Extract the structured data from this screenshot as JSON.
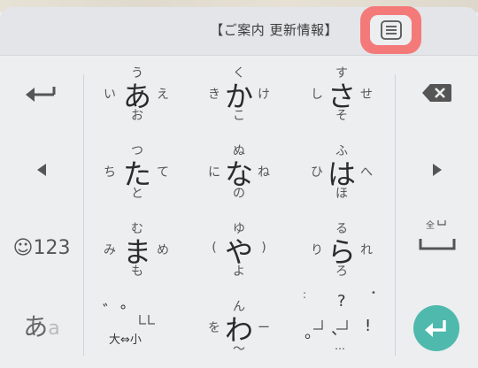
{
  "notice": "【ご案内 更新情報】",
  "rows": [
    [
      {
        "center": "あ",
        "top": "う",
        "left": "い",
        "right": "え",
        "bottom": "お"
      },
      {
        "center": "か",
        "top": "く",
        "left": "き",
        "right": "け",
        "bottom": "こ"
      },
      {
        "center": "さ",
        "top": "す",
        "left": "し",
        "right": "せ",
        "bottom": "そ"
      }
    ],
    [
      {
        "center": "た",
        "top": "つ",
        "left": "ち",
        "right": "て",
        "bottom": "と"
      },
      {
        "center": "な",
        "top": "ぬ",
        "left": "に",
        "right": "ね",
        "bottom": "の"
      },
      {
        "center": "は",
        "top": "ふ",
        "left": "ひ",
        "right": "へ",
        "bottom": "ほ"
      }
    ],
    [
      {
        "center": "ま",
        "top": "む",
        "left": "み",
        "right": "め",
        "bottom": "も"
      },
      {
        "center": "や",
        "top": "ゆ",
        "left": "(",
        "right": ")",
        "bottom": "よ"
      },
      {
        "center": "ら",
        "top": "る",
        "left": "り",
        "right": "れ",
        "bottom": "ろ"
      }
    ],
    [
      {
        "center": "",
        "top": "",
        "left": "",
        "right": "",
        "bottom": ""
      },
      {
        "center": "わ",
        "top": "ん",
        "left": "を",
        "right": "ー",
        "bottom": "〜"
      },
      {
        "center": "",
        "top": "?",
        "left": "",
        "right": "!",
        "bottom": "…"
      }
    ]
  ],
  "left_column": {
    "emoji_label": "☺123",
    "mode_main": "あ",
    "mode_sub": "a"
  },
  "daku": {
    "dakuten": "゛",
    "handakuten": "゜",
    "small_label": "大⇔小"
  },
  "punct": {
    "colon": ":",
    "dot": "•",
    "period": "。",
    "comma": "、"
  },
  "right_column": {
    "zenkaku_label": "全"
  },
  "colors": {
    "accent_enter": "#4fb9ad",
    "highlight": "#f47a7a",
    "background": "#eceef0"
  }
}
